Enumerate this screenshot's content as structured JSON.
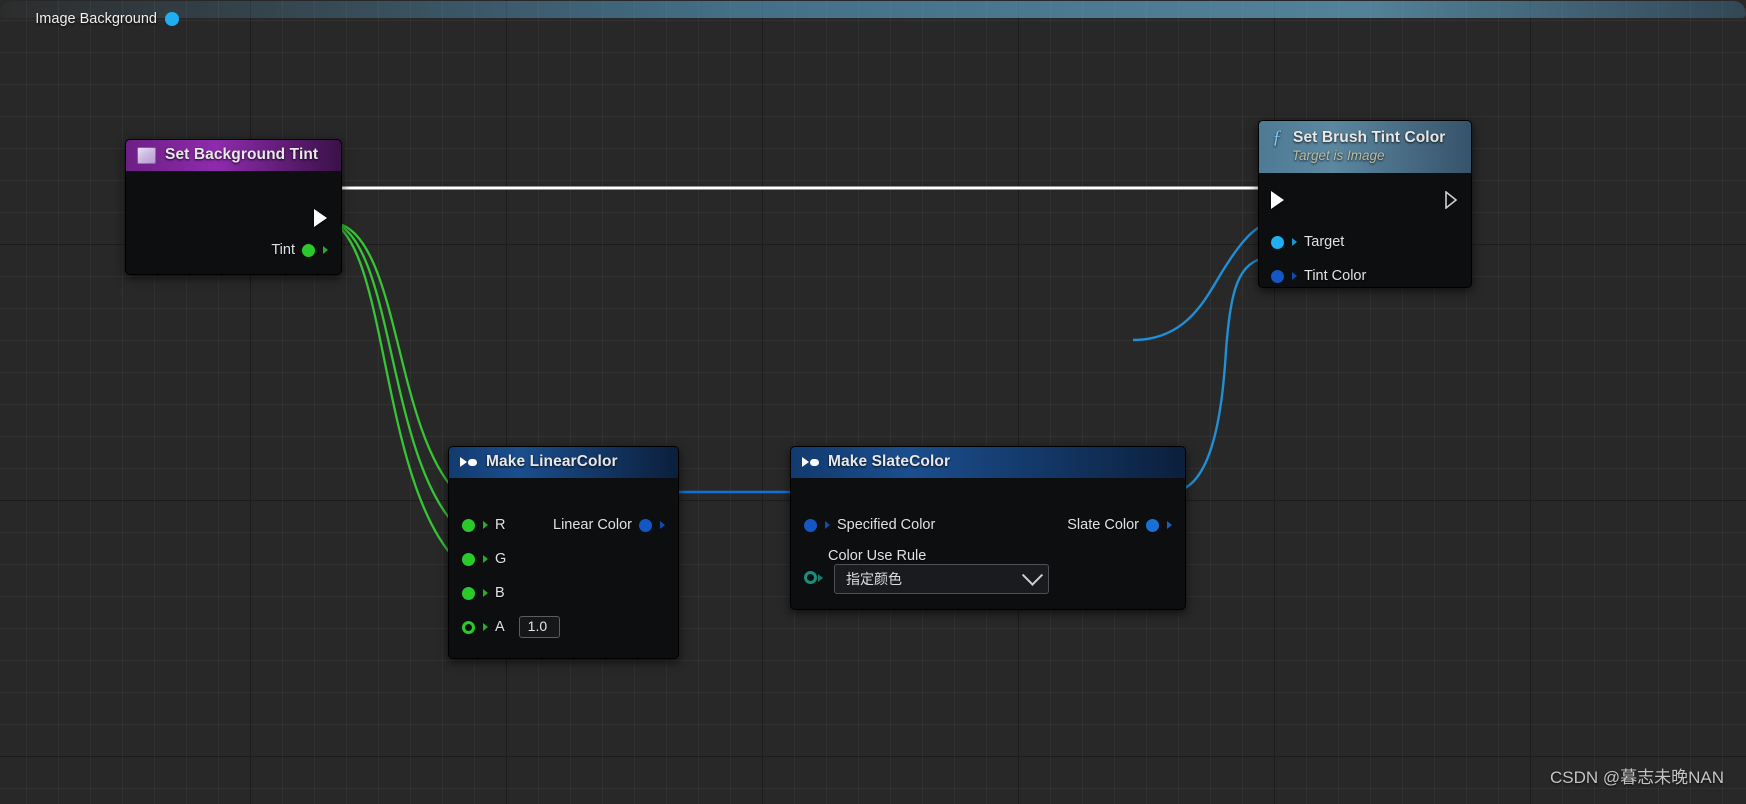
{
  "canvas": {
    "background_color": "#282828",
    "grid_line_color": "#333333",
    "grid_major_color": "#1a1a1a"
  },
  "nodes": {
    "set_background_tint": {
      "title": "Set Background Tint",
      "header_color": "#8e2bad",
      "icon": "variable-swatch-icon",
      "exec_out_label": "",
      "output_pin_label": "Tint",
      "output_pin_color": "#2aca2a"
    },
    "set_brush_tint_color": {
      "title": "Set Brush Tint Color",
      "subtitle": "Target is Image",
      "header_color": "#5b87a0",
      "icon": "function-fx-icon",
      "pins": [
        {
          "label": "Target",
          "color": "#1faeef",
          "kind": "object"
        },
        {
          "label": "Tint Color",
          "color": "#1257c4",
          "kind": "struct"
        }
      ]
    },
    "image_background": {
      "title": "Image Background",
      "header_color": "#4aa0cc",
      "output_pin_color": "#1faeef"
    },
    "make_linearcolor": {
      "title": "Make LinearColor",
      "header_color": "#1b4e8e",
      "icon": "pure-function-icon",
      "inputs": [
        {
          "label": "R",
          "color": "#2aca2a",
          "value": "",
          "connected": true
        },
        {
          "label": "G",
          "color": "#2aca2a",
          "value": "",
          "connected": true
        },
        {
          "label": "B",
          "color": "#2aca2a",
          "value": "",
          "connected": true
        },
        {
          "label": "A",
          "color": "#2aca2a",
          "value": "1.0",
          "connected": false
        }
      ],
      "output": {
        "label": "Linear Color",
        "color": "#1257c4"
      }
    },
    "make_slatecolor": {
      "title": "Make SlateColor",
      "header_color": "#1b4e8e",
      "icon": "pure-function-icon",
      "input": {
        "label": "Specified Color",
        "color": "#1257c4"
      },
      "output": {
        "label": "Slate Color",
        "color": "#1a6fd4"
      },
      "rule_label": "Color Use Rule",
      "rule_pin_color": "#1b8f7e",
      "rule_value": "指定颜色"
    }
  },
  "wires": {
    "exec_color": "#ffffff",
    "data_green": "#35c535",
    "data_blue": "#1072d8",
    "data_cyan": "#1f8fd6"
  },
  "watermark": {
    "text": "CSDN @暮志未晚NAN"
  }
}
